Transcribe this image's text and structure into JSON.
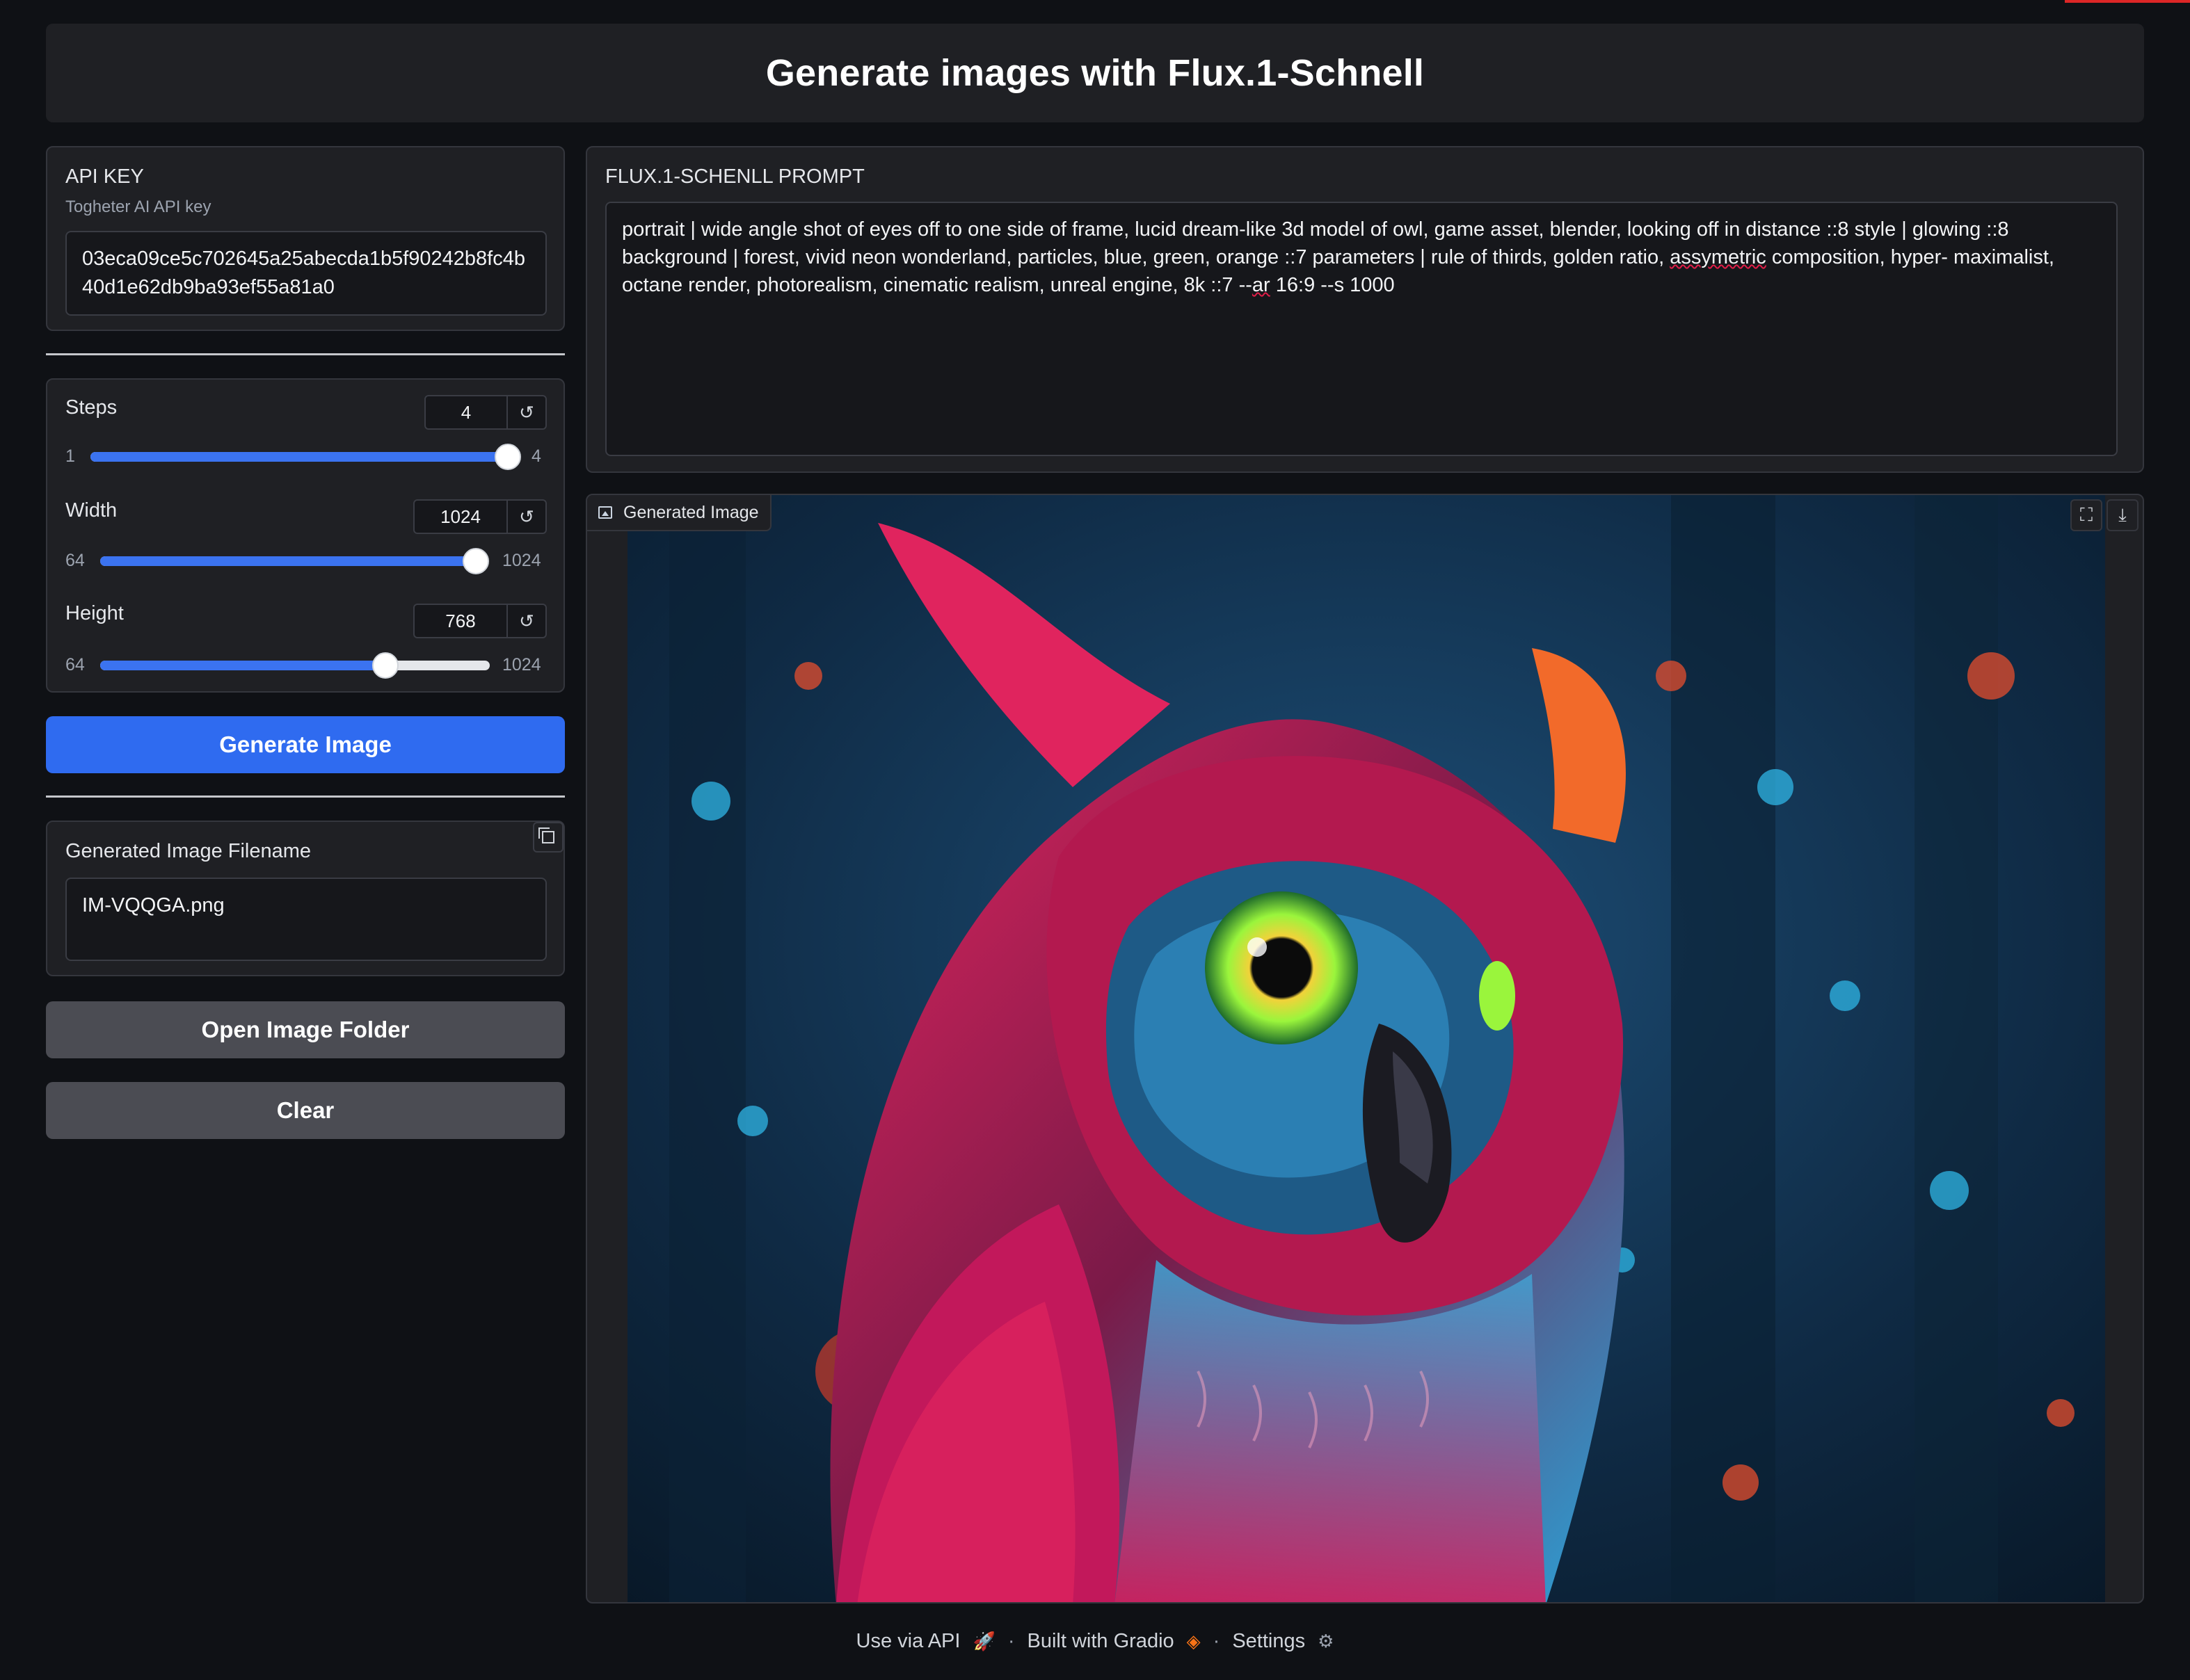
{
  "header": {
    "title": "Generate images with Flux.1-Schnell"
  },
  "api_key": {
    "label": "API KEY",
    "sublabel": "Togheter AI API key",
    "value": "03eca09ce5c702645a25abecda1b5f90242b8fc4b40d1e62db9ba93ef55a81a0"
  },
  "sliders": {
    "steps": {
      "label": "Steps",
      "value": "4",
      "min": "1",
      "max": "4",
      "fraction": 1.0
    },
    "width": {
      "label": "Width",
      "value": "1024",
      "min": "64",
      "max": "1024",
      "fraction": 1.0
    },
    "height": {
      "label": "Height",
      "value": "768",
      "min": "64",
      "max": "1024",
      "fraction": 0.733
    },
    "reset_glyph": "↺"
  },
  "buttons": {
    "generate": "Generate Image",
    "open_folder": "Open Image Folder",
    "clear": "Clear"
  },
  "filename": {
    "label": "Generated Image Filename",
    "value": "IM-VQQGA.png"
  },
  "prompt": {
    "label": "FLUX.1-SCHENLL PROMPT",
    "text_part1": "portrait | wide angle shot of eyes off to one side of frame, lucid dream-like 3d model of owl, game asset, blender, looking off in distance ::8 style | glowing ::8 background | forest, vivid neon wonderland, particles, blue, green, orange ::7 parameters | rule of thirds, golden ratio, ",
    "text_misspelled": "assymetric",
    "text_part2": " composition, hyper- maximalist, octane render, photorealism, cinematic realism, unreal engine, 8k ::7 --",
    "text_ar": "ar",
    "text_part3": " 16:9 --s 1000"
  },
  "image": {
    "label": "Generated Image",
    "icons": [
      "image-icon",
      "fullscreen-icon",
      "download-icon"
    ],
    "colors": {
      "background": "#0f2a44",
      "owl_magenta": "#d81b5a",
      "owl_blue": "#2aa3d8",
      "eye": "#9af53c"
    }
  },
  "footer": {
    "api": "Use via API",
    "built": "Built with Gradio",
    "settings": "Settings",
    "sep": "·"
  }
}
